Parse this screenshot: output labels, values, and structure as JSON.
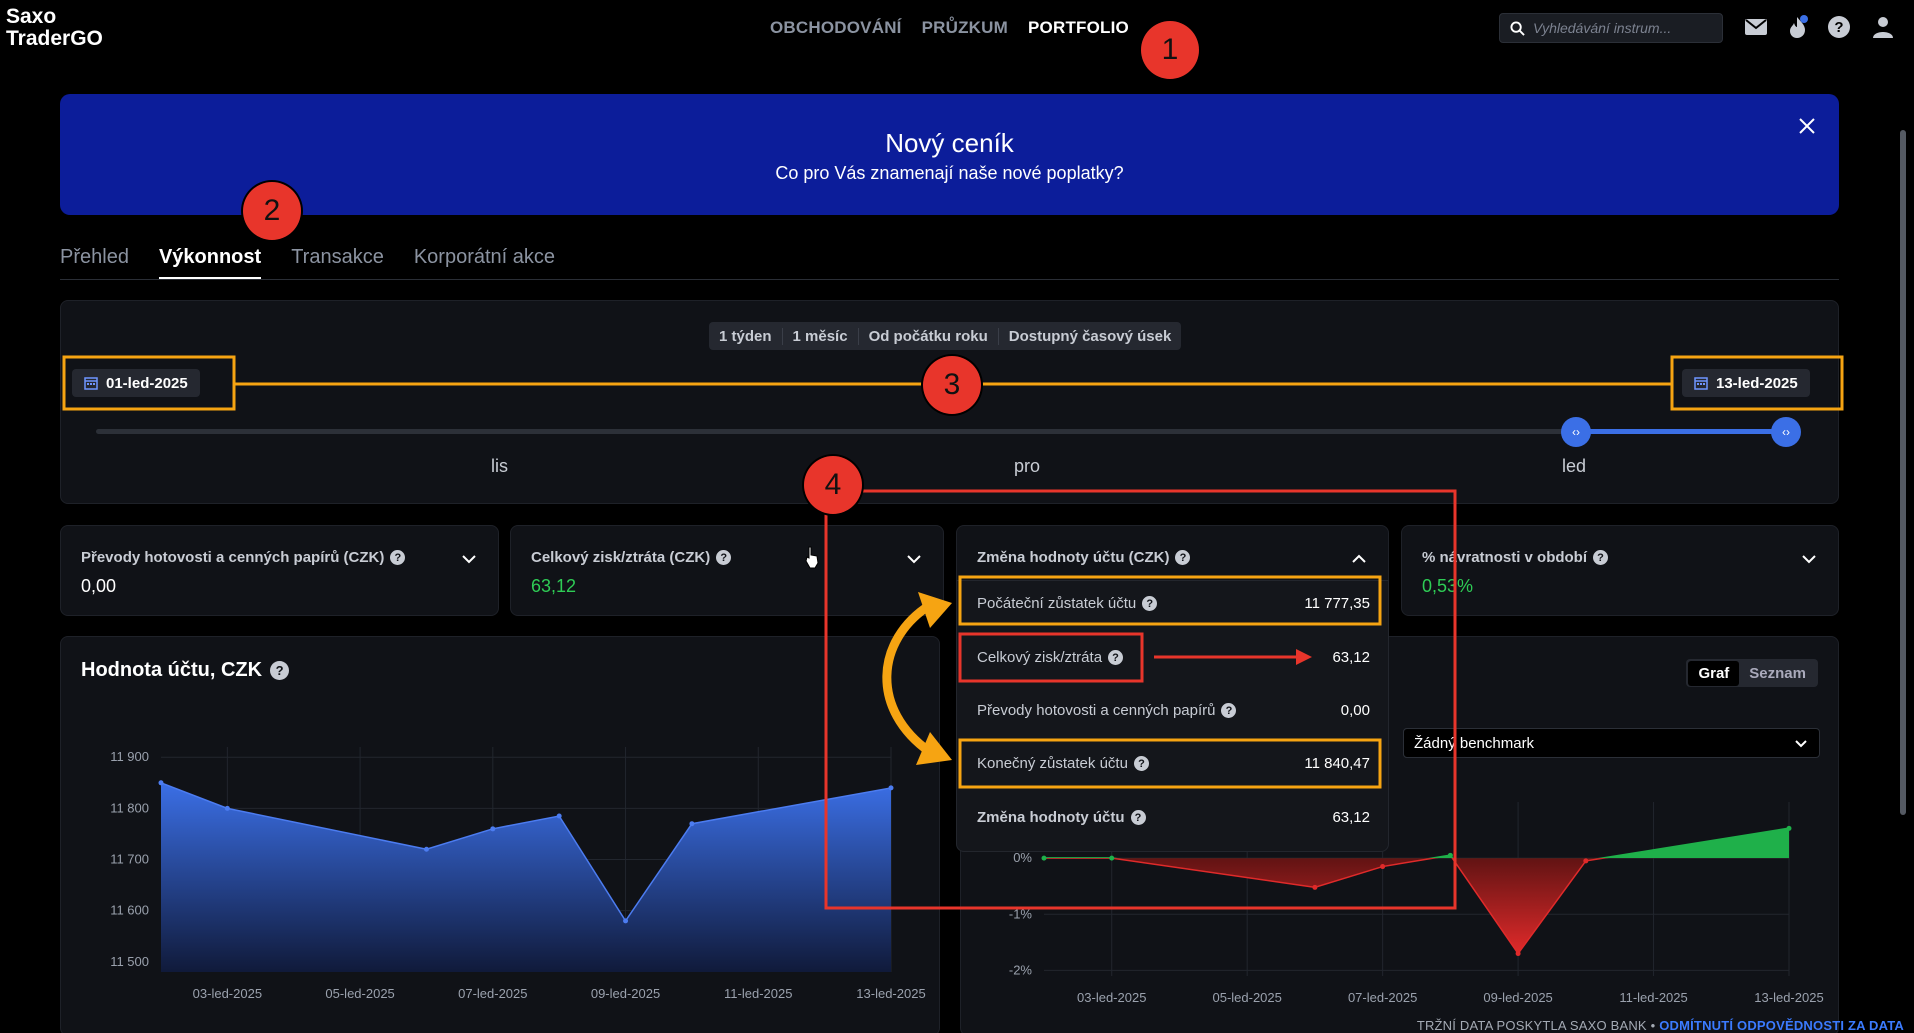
{
  "header": {
    "logo_line1": "Saxo",
    "logo_line2": "TraderGO",
    "nav": [
      "OBCHODOVÁNÍ",
      "PRŮZKUM",
      "PORTFOLIO"
    ],
    "search_placeholder": "Vyhledávání instrum...",
    "icons": [
      "mail-icon",
      "flame-icon",
      "help-icon",
      "user-icon"
    ],
    "accent": "#3b6fe6"
  },
  "annotations": [
    "1",
    "2",
    "3",
    "4"
  ],
  "banner": {
    "title": "Nový ceník",
    "subtitle": "Co pro Vás znamenají naše nové poplatky?",
    "background": "#0c1d9a"
  },
  "tabs": [
    "Přehled",
    "Výkonnost",
    "Transakce",
    "Korporátní akce"
  ],
  "period": {
    "options": [
      "1 týden",
      "1 měsíc",
      "Od počátku roku",
      "Dostupný časový úsek"
    ],
    "start_date": "01-led-2025",
    "end_date": "13-led-2025",
    "months": [
      "lis",
      "pro",
      "led"
    ]
  },
  "cards": [
    {
      "label": "Převody hotovosti a cenných papírů (CZK)",
      "value": "0,00"
    },
    {
      "label": "Celkový zisk/ztráta (CZK)",
      "value": "63,12"
    },
    {
      "label": "Změna hodnoty účtu (CZK)",
      "value": ""
    },
    {
      "label": "% návratnosti v období",
      "value": "0,53%"
    }
  ],
  "breakdown": [
    {
      "label": "Počáteční zůstatek účtu",
      "value": "11 777,35"
    },
    {
      "label": "Celkový zisk/ztráta",
      "value": "63,12"
    },
    {
      "label": "Převody hotovosti a cenných papírů",
      "value": "0,00"
    },
    {
      "label": "Konečný zůstatek účtu",
      "value": "11 840,47"
    },
    {
      "label": "Změna hodnoty účtu",
      "value": "63,12"
    }
  ],
  "account_chart": {
    "title": "Hodnota účtu, CZK"
  },
  "returns_chart": {
    "toggle": [
      "Graf",
      "Seznam"
    ],
    "benchmark": "Žádný benchmark"
  },
  "footer": {
    "text": "TRŽNÍ DATA POSKYTLA SAXO BANK •",
    "link": "ODMÍTNUTÍ ODPOVĚDNOSTI ZA DATA"
  },
  "chart_data": [
    {
      "type": "area",
      "title": "Hodnota účtu, CZK",
      "x": [
        "02-led-2025",
        "03-led-2025",
        "06-led-2025",
        "07-led-2025",
        "08-led-2025",
        "09-led-2025",
        "10-led-2025",
        "13-led-2025"
      ],
      "x_tick_labels": [
        "03-led-2025",
        "05-led-2025",
        "07-led-2025",
        "09-led-2025",
        "11-led-2025",
        "13-led-2025"
      ],
      "values": [
        11850,
        11800,
        11720,
        11760,
        11785,
        11580,
        11770,
        11840
      ],
      "ylim": [
        11480,
        11920
      ],
      "y_ticks": [
        11500,
        11600,
        11700,
        11800,
        11900
      ],
      "y_tick_labels": [
        "11 500",
        "11 600",
        "11 700",
        "11 800",
        "11 900"
      ],
      "color": "#3b6fe6",
      "grid": true
    },
    {
      "type": "area",
      "x": [
        "02-led-2025",
        "03-led-2025",
        "06-led-2025",
        "07-led-2025",
        "08-led-2025",
        "09-led-2025",
        "10-led-2025",
        "13-led-2025"
      ],
      "x_tick_labels": [
        "03-led-2025",
        "05-led-2025",
        "07-led-2025",
        "09-led-2025",
        "11-led-2025",
        "13-led-2025"
      ],
      "values": [
        0.0,
        0.0,
        -0.52,
        -0.15,
        0.05,
        -1.7,
        -0.05,
        0.53
      ],
      "ylim": [
        -2.1,
        1.0
      ],
      "y_ticks": [
        -2,
        -1,
        0
      ],
      "y_tick_labels": [
        "-2%",
        "-1%",
        "0%"
      ],
      "positive_color": "#1fb04a",
      "negative_color": "#e02a2a",
      "grid": true
    }
  ]
}
